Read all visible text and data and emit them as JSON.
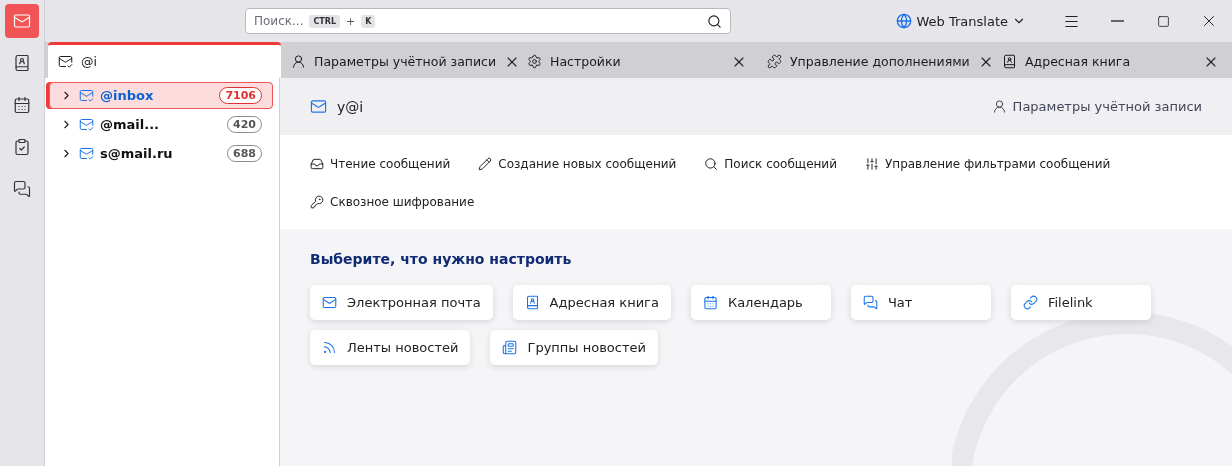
{
  "spaces_toolbar": [
    {
      "kind": "mail",
      "selected": true
    },
    {
      "kind": "contacts",
      "selected": false
    },
    {
      "kind": "calendar",
      "selected": false
    },
    {
      "kind": "tasks",
      "selected": false
    },
    {
      "kind": "chat",
      "selected": false
    }
  ],
  "search": {
    "placeholder": "Поиск...",
    "keys": [
      "CTRL",
      "K"
    ],
    "separator": "+"
  },
  "web_translate": {
    "label": "Web Translate"
  },
  "tabs": [
    {
      "kind": "folder",
      "label": "@i",
      "selected": true,
      "closable": false
    },
    {
      "kind": "account",
      "label": "Параметры учётной записи",
      "selected": false,
      "closable": true
    },
    {
      "kind": "settings",
      "label": "Настройки",
      "selected": false,
      "closable": true
    },
    {
      "kind": "addons",
      "label": "Управление дополнениями",
      "selected": false,
      "closable": true
    },
    {
      "kind": "addressbook",
      "label": "Адресная книга",
      "selected": false,
      "closable": true
    }
  ],
  "folder_pane": {
    "accounts": [
      {
        "name": "@inbox",
        "count": "7106",
        "selected": true
      },
      {
        "name": "@mail...",
        "count": "420",
        "selected": false
      },
      {
        "name": "s@mail.ru",
        "count": "688",
        "selected": false
      }
    ]
  },
  "account_header": {
    "address": "y@i",
    "settings_link": "Параметры учётной записи"
  },
  "actions": [
    {
      "kind": "read",
      "label": "Чтение сообщений"
    },
    {
      "kind": "compose",
      "label": "Создание новых сообщений"
    },
    {
      "kind": "search",
      "label": "Поиск сообщений"
    },
    {
      "kind": "filters",
      "label": "Управление фильтрами сообщений"
    },
    {
      "kind": "e2e",
      "label": "Сквозное шифрование"
    }
  ],
  "setup": {
    "title": "Выберите, что нужно настроить",
    "cards": [
      {
        "kind": "email",
        "label": "Электронная почта"
      },
      {
        "kind": "addressbook",
        "label": "Адресная книга"
      },
      {
        "kind": "calendar",
        "label": "Календарь"
      },
      {
        "kind": "chat",
        "label": "Чат"
      },
      {
        "kind": "filelink",
        "label": "Filelink"
      },
      {
        "kind": "feeds",
        "label": "Ленты новостей"
      },
      {
        "kind": "newsgroups",
        "label": "Группы новостей"
      }
    ]
  }
}
